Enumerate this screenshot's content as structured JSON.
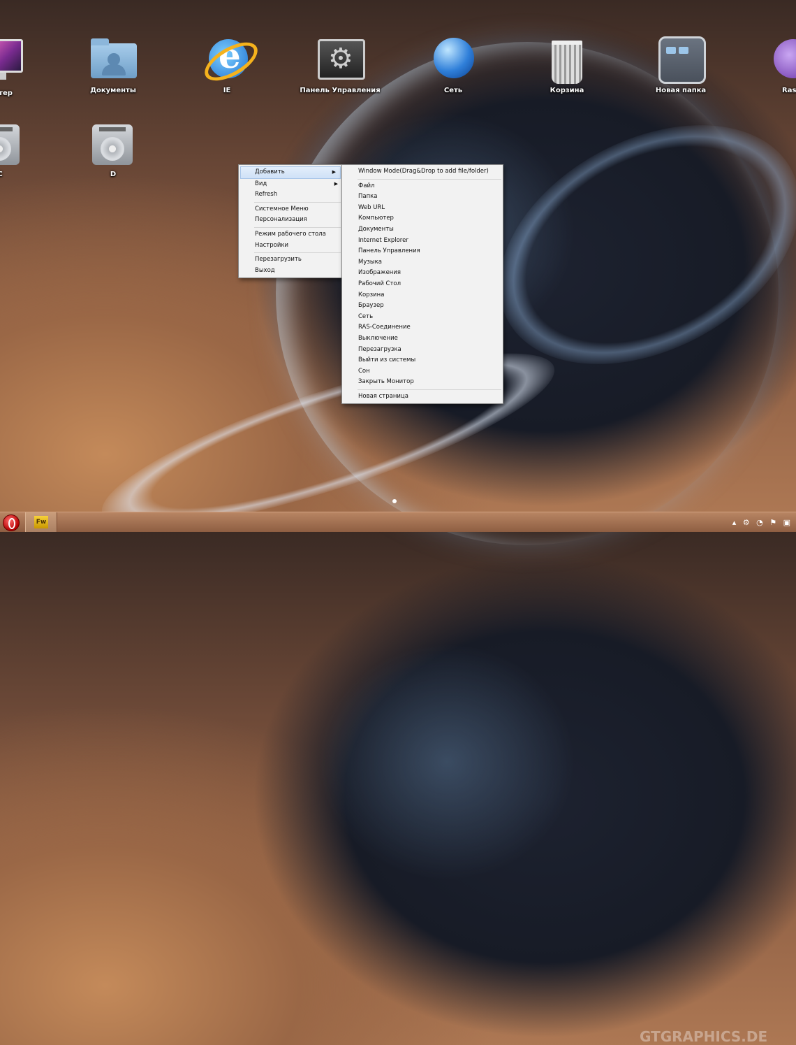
{
  "desktop": {
    "icons_row1": [
      {
        "label": "ьютер",
        "icon": "computer-icon"
      },
      {
        "label": "Документы",
        "icon": "documents-folder-icon"
      },
      {
        "label": "IE",
        "icon": "internet-explorer-icon"
      },
      {
        "label": "Панель Управления",
        "icon": "control-panel-icon"
      },
      {
        "label": "Сеть",
        "icon": "network-globe-icon"
      },
      {
        "label": "Корзина",
        "icon": "recycle-bin-icon"
      },
      {
        "label": "Новая папка",
        "icon": "new-folder-icon"
      },
      {
        "label": "RasL",
        "icon": "ras-connection-icon"
      }
    ],
    "icons_row2": [
      {
        "label": "C",
        "icon": "hard-drive-icon"
      },
      {
        "label": "D",
        "icon": "hard-drive-icon"
      }
    ]
  },
  "context_menu": {
    "items": [
      {
        "label": "Добавить",
        "submenu": true,
        "highlighted": true
      },
      {
        "label": "Вид",
        "submenu": true
      },
      {
        "label": "Refresh"
      },
      {
        "label": "Системное Меню"
      },
      {
        "label": "Персонализация"
      },
      {
        "label": "Режим рабочего стола"
      },
      {
        "label": "Настройки"
      },
      {
        "label": "Перезагрузить"
      },
      {
        "label": "Выход"
      }
    ]
  },
  "submenu": {
    "header": "Window Mode(Drag&Drop to add file/folder)",
    "items": [
      "Файл",
      "Папка",
      "Web URL",
      "Компьютер",
      "Документы",
      "Internet Explorer",
      "Панель Управления",
      "Музыка",
      "Изображения",
      "Рабочий Стол",
      "Корзина",
      "Браузер",
      "Сеть",
      "RAS-Соединение",
      "Выключение",
      "Перезагрузка",
      "Выйти из системы",
      "Сон",
      "Закрыть Монитор"
    ],
    "footer": "Новая страница"
  },
  "taskbar": {
    "app_label": "Fw",
    "watermark": "GTGRAPHICS.DE",
    "tray_icons": [
      "arrow-up-icon",
      "gear-icon",
      "clock-icon",
      "flag-icon",
      "network-icon"
    ]
  },
  "arrow_glyph": "▶"
}
